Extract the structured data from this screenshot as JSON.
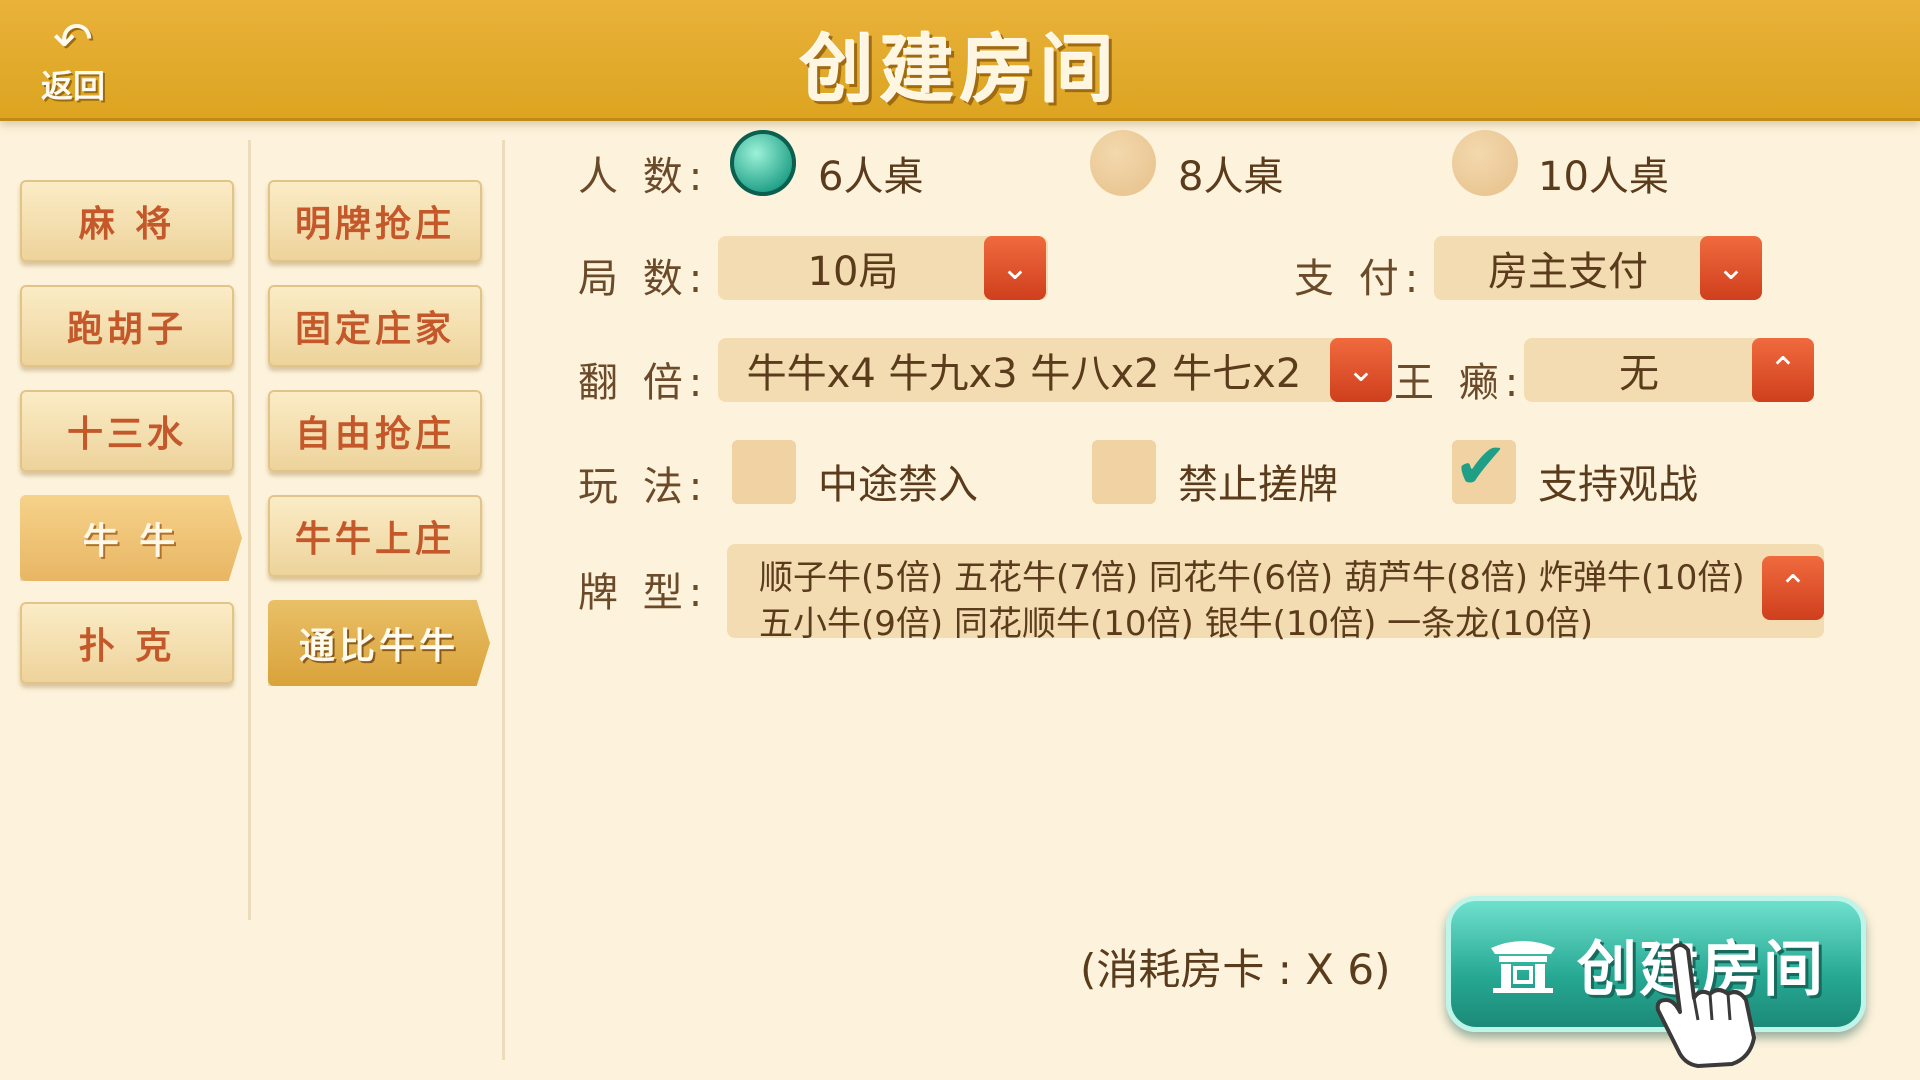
{
  "header": {
    "back_label": "返回",
    "title": "创建房间"
  },
  "categories_left": [
    {
      "label": "麻 将",
      "active": false
    },
    {
      "label": "跑胡子",
      "active": false
    },
    {
      "label": "十三水",
      "active": false
    },
    {
      "label": "牛 牛",
      "active": true
    },
    {
      "label": "扑 克",
      "active": false
    }
  ],
  "categories_right": [
    {
      "label": "明牌抢庄",
      "active": false
    },
    {
      "label": "固定庄家",
      "active": false
    },
    {
      "label": "自由抢庄",
      "active": false
    },
    {
      "label": "牛牛上庄",
      "active": false
    },
    {
      "label": "通比牛牛",
      "active": true
    }
  ],
  "form": {
    "players": {
      "label": "人 数:",
      "options": [
        {
          "text": "6人桌",
          "checked": true
        },
        {
          "text": "8人桌",
          "checked": false
        },
        {
          "text": "10人桌",
          "checked": false
        }
      ]
    },
    "rounds": {
      "label": "局 数:",
      "value": "10局"
    },
    "payment": {
      "label": "支 付:",
      "value": "房主支付"
    },
    "multiplier": {
      "label": "翻 倍:",
      "value": "牛牛x4 牛九x3 牛八x2 牛七x2"
    },
    "wild": {
      "label": "王 癞:",
      "value": "无"
    },
    "rules": {
      "label": "玩 法:",
      "options": [
        {
          "text": "中途禁入",
          "checked": false
        },
        {
          "text": "禁止搓牌",
          "checked": false
        },
        {
          "text": "支持观战",
          "checked": true
        }
      ]
    },
    "card_types": {
      "label": "牌 型:",
      "line1": "顺子牛(5倍) 五花牛(7倍) 同花牛(6倍) 葫芦牛(8倍) 炸弹牛(10倍)",
      "line2": "五小牛(9倍) 同花顺牛(10倍) 银牛(10倍) 一条龙(10倍)"
    }
  },
  "footer": {
    "cost": "(消耗房卡 : X 6)",
    "create_label": "创建房间"
  },
  "colors": {
    "header": "#dca420",
    "accent_teal": "#26a892",
    "arrow_red": "#cf3f1d",
    "background": "#fdf3dc"
  }
}
